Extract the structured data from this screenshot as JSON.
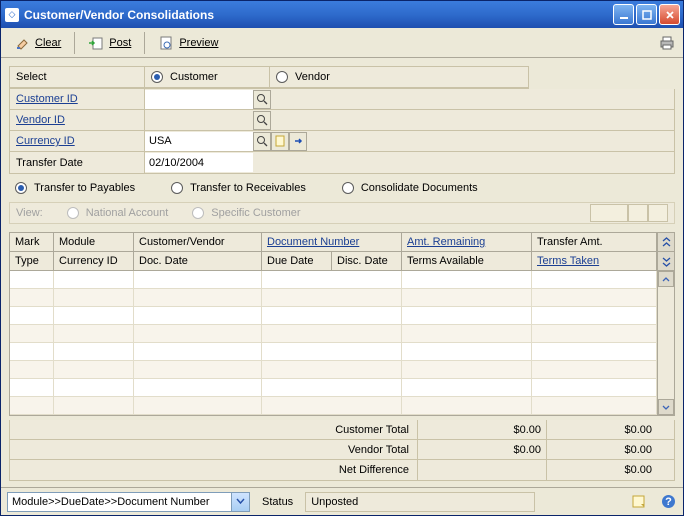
{
  "window": {
    "title": "Customer/Vendor Consolidations"
  },
  "toolbar": {
    "clear": "Clear",
    "post": "Post",
    "preview": "Preview"
  },
  "select": {
    "label": "Select",
    "options": {
      "customer": "Customer",
      "vendor": "Vendor"
    },
    "selected": "customer"
  },
  "fields": {
    "customer_id_label": "Customer ID",
    "customer_id_value": "",
    "customer_name": "",
    "vendor_id_label": "Vendor ID",
    "vendor_id_value": "",
    "vendor_name": "",
    "currency_id_label": "Currency ID",
    "currency_id_value": "USA",
    "transfer_date_label": "Transfer Date",
    "transfer_date_value": "02/10/2004"
  },
  "transfer": {
    "options": {
      "payables": "Transfer to Payables",
      "receivables": "Transfer to Receivables",
      "consolidate": "Consolidate Documents"
    },
    "selected": "payables"
  },
  "view": {
    "label": "View:",
    "options": {
      "national": "National Account",
      "specific": "Specific Customer"
    }
  },
  "grid": {
    "headers": {
      "mark": "Mark",
      "module": "Module",
      "customer_vendor": "Customer/Vendor",
      "doc_number": "Document Number",
      "amt_remaining": "Amt. Remaining",
      "transfer_amt": "Transfer Amt."
    },
    "subheaders": {
      "type": "Type",
      "currency_id": "Currency ID",
      "doc_date": "Doc. Date",
      "due_date": "Due Date",
      "disc_date": "Disc. Date",
      "terms_available": "Terms Available",
      "terms_taken": "Terms Taken"
    }
  },
  "totals": {
    "customer_total_label": "Customer Total",
    "customer_total_1": "$0.00",
    "customer_total_2": "$0.00",
    "vendor_total_label": "Vendor Total",
    "vendor_total_1": "$0.00",
    "vendor_total_2": "$0.00",
    "net_diff_label": "Net Difference",
    "net_diff_val": "$0.00"
  },
  "statusbar": {
    "sort": "Module>>DueDate>>Document Number",
    "status_label": "Status",
    "status_value": "Unposted"
  }
}
